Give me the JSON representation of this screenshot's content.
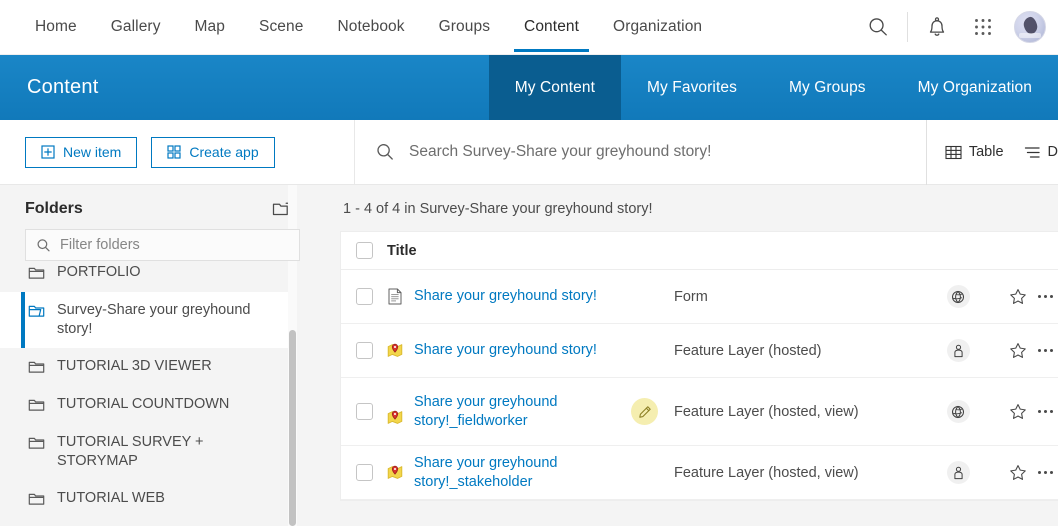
{
  "topnav": {
    "links": [
      {
        "label": "Home",
        "active": false
      },
      {
        "label": "Gallery",
        "active": false
      },
      {
        "label": "Map",
        "active": false
      },
      {
        "label": "Scene",
        "active": false
      },
      {
        "label": "Notebook",
        "active": false
      },
      {
        "label": "Groups",
        "active": false
      },
      {
        "label": "Content",
        "active": true
      },
      {
        "label": "Organization",
        "active": false
      }
    ],
    "icons": {
      "search": "search-icon",
      "notifications": "bell-icon",
      "apps": "app-grid-icon",
      "avatar": "user-avatar"
    }
  },
  "banner": {
    "title": "Content",
    "tabs": [
      {
        "label": "My Content",
        "active": true
      },
      {
        "label": "My Favorites",
        "active": false
      },
      {
        "label": "My Groups",
        "active": false
      },
      {
        "label": "My Organization",
        "active": false
      }
    ],
    "accent_active": "#0a5d90",
    "accent": "#1683c4"
  },
  "toolbar": {
    "new_item_label": "New item",
    "create_app_label": "Create app",
    "search_placeholder": "Search Survey-Share your greyhound story!",
    "search_value": "",
    "view_table_label": "Table",
    "view_details_label": "D"
  },
  "folders": {
    "title": "Folders",
    "add_folder_icon": "add-folder-icon",
    "filter_placeholder": "Filter folders",
    "filter_value": "",
    "items": [
      {
        "label": "PORTFOLIO",
        "selected": false
      },
      {
        "label": "Survey-Share your greyhound story!",
        "selected": true
      },
      {
        "label": "TUTORIAL 3D VIEWER",
        "selected": false
      },
      {
        "label": "TUTORIAL COUNTDOWN",
        "selected": false
      },
      {
        "label": "TUTORIAL SURVEY + STORYMAP",
        "selected": false
      },
      {
        "label": "TUTORIAL WEB",
        "selected": false
      }
    ]
  },
  "results": {
    "count_text": "1 - 4 of 4 in Survey-Share your greyhound story!",
    "column_title": "Title",
    "rows": [
      {
        "title": "Share your greyhound story!",
        "type": "Form",
        "item_icon": "form-document-icon",
        "share_icon": "globe-icon",
        "has_edit_badge": false,
        "favorite": false
      },
      {
        "title": "Share your greyhound story!",
        "type": "Feature Layer (hosted)",
        "item_icon": "feature-layer-pin-icon",
        "share_icon": "person-icon",
        "has_edit_badge": false,
        "favorite": false
      },
      {
        "title": "Share your greyhound story!_fieldworker",
        "type": "Feature Layer (hosted, view)",
        "item_icon": "feature-layer-pin-icon",
        "share_icon": "globe-icon",
        "has_edit_badge": true,
        "favorite": false
      },
      {
        "title": "Share your greyhound story!_stakeholder",
        "type": "Feature Layer (hosted, view)",
        "item_icon": "feature-layer-pin-icon",
        "share_icon": "person-icon",
        "has_edit_badge": false,
        "favorite": false
      }
    ]
  }
}
